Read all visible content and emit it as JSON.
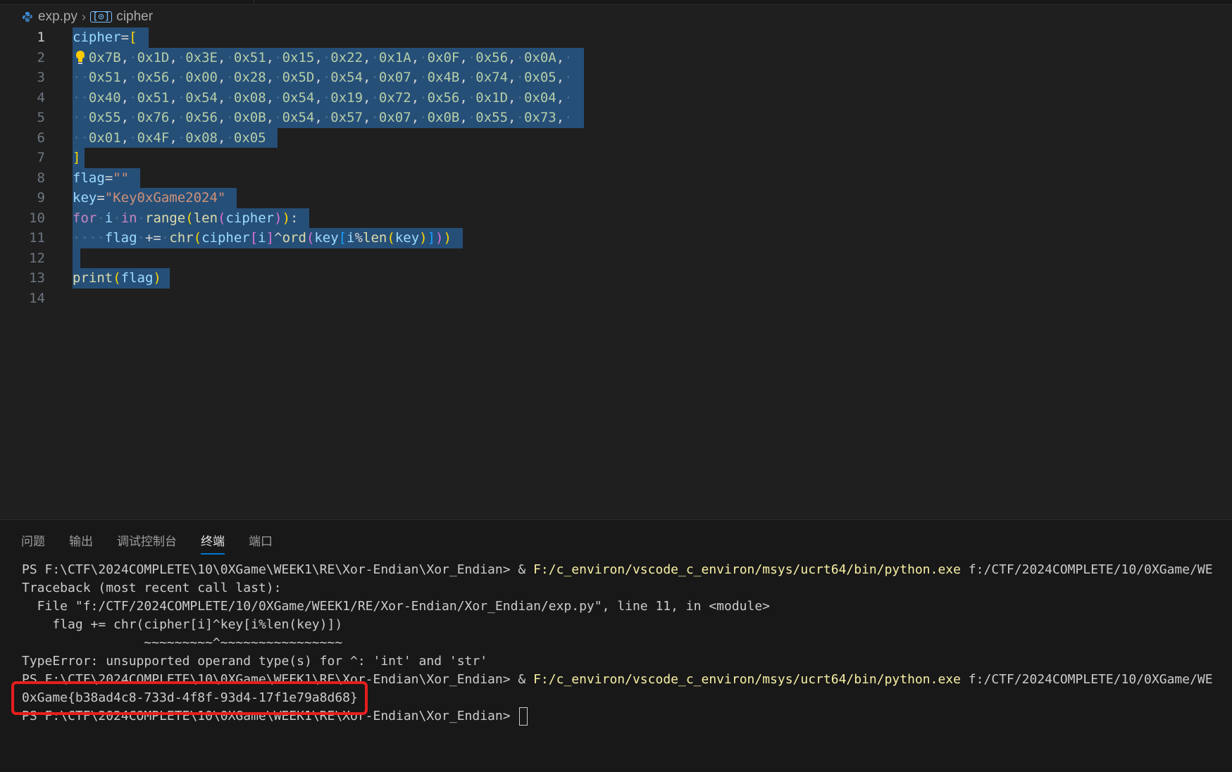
{
  "breadcrumb": {
    "file": "exp.py",
    "symbol": "cipher"
  },
  "editor": {
    "line_numbers": [
      "1",
      "2",
      "3",
      "4",
      "5",
      "6",
      "7",
      "8",
      "9",
      "10",
      "11",
      "12",
      "13",
      "14"
    ],
    "cipher_open": "cipher",
    "cipher_rows": [
      [
        "0x7B",
        "0x1D",
        "0x3E",
        "0x51",
        "0x15",
        "0x22",
        "0x1A",
        "0x0F",
        "0x56",
        "0x0A"
      ],
      [
        "0x51",
        "0x56",
        "0x00",
        "0x28",
        "0x5D",
        "0x54",
        "0x07",
        "0x4B",
        "0x74",
        "0x05"
      ],
      [
        "0x40",
        "0x51",
        "0x54",
        "0x08",
        "0x54",
        "0x19",
        "0x72",
        "0x56",
        "0x1D",
        "0x04"
      ],
      [
        "0x55",
        "0x76",
        "0x56",
        "0x0B",
        "0x54",
        "0x57",
        "0x07",
        "0x0B",
        "0x55",
        "0x73"
      ],
      [
        "0x01",
        "0x4F",
        "0x08",
        "0x05"
      ]
    ],
    "close_bracket": "]",
    "flag_var": "flag",
    "flag_value": "\"\"",
    "key_var": "key",
    "key_value": "\"Key0xGame2024\"",
    "for_kw": "for",
    "loop_var": "i",
    "in_kw": "in",
    "range_fn": "range",
    "len_fn": "len",
    "cipher_var": "cipher",
    "aug_op": "+=",
    "chr_fn": "chr",
    "ord_fn": "ord",
    "print_fn": "print"
  },
  "panel": {
    "tabs": [
      "问题",
      "输出",
      "调试控制台",
      "终端",
      "端口"
    ],
    "active_tab": "终端"
  },
  "terminal": {
    "prompt": "PS F:\\CTF\\2024COMPLETE\\10\\0XGame\\WEEK1\\RE\\Xor-Endian\\Xor_Endian> ",
    "amp": "& ",
    "python_exe": "F:/c_environ/vscode_c_environ/msys/ucrt64/bin/python.exe",
    "script_arg": " f:/CTF/2024COMPLETE/10/0XGame/WE",
    "traceback": "Traceback (most recent call last):",
    "file_line": "  File \"f:/CTF/2024COMPLETE/10/0XGame/WEEK1/RE/Xor-Endian/Xor_Endian/exp.py\", line 11, in <module>",
    "code_line": "    flag += chr(cipher[i]^key[i%len(key)])",
    "caret_line": "                ~~~~~~~~~^~~~~~~~~~~~~~~~~",
    "error": "TypeError: unsupported operand type(s) for ^: 'int' and 'str'",
    "flag_output": "0xGame{b38ad4c8-733d-4f8f-93d4-17f1e79a8d68}",
    "final_prompt": "PS F:\\CTF\\2024COMPLETE\\10\\0XGame\\WEEK1\\RE\\Xor-Endian\\Xor_Endian> "
  },
  "colors": {
    "editor_bg": "#1f1f1f",
    "selection": "#264f78",
    "terminal_yellow": "#f9f1a5",
    "highlight_box": "#e51e1e",
    "tab_underline": "#0078d4"
  }
}
